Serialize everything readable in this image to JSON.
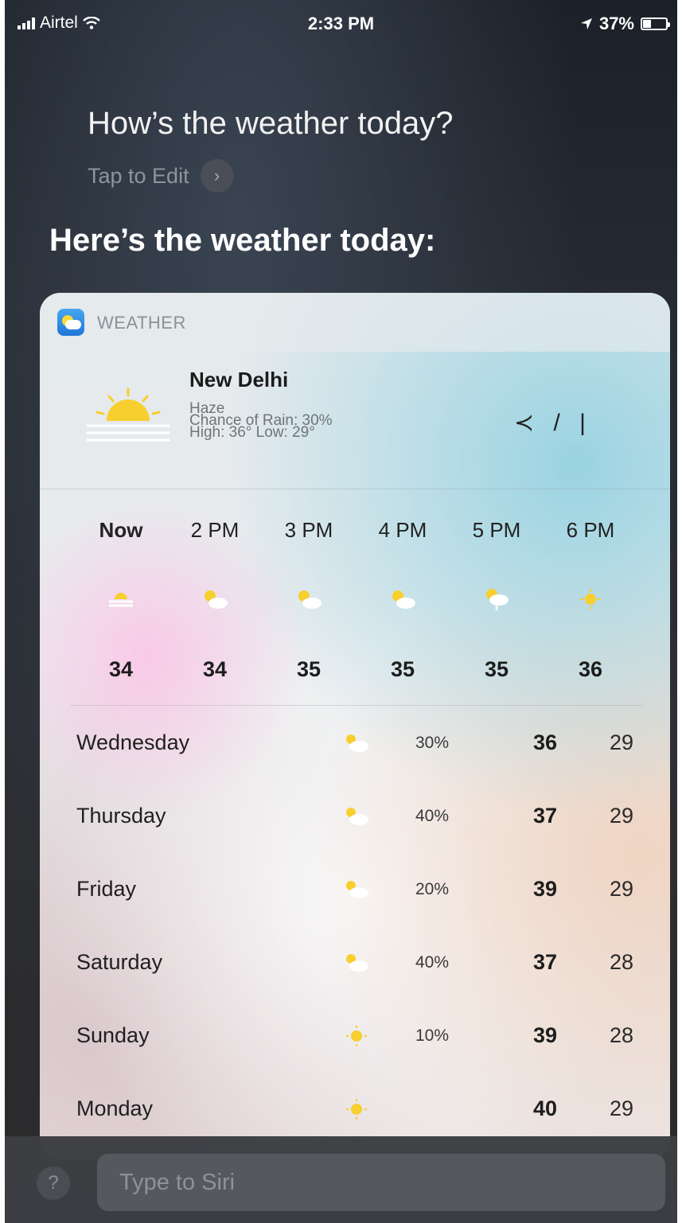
{
  "status_bar": {
    "carrier": "Airtel",
    "time": "2:33 PM",
    "battery": "37%",
    "battery_level": 0.37
  },
  "siri": {
    "query": "How’s the weather today?",
    "tap_to_edit": "Tap to Edit",
    "answer": "Here’s the weather today:"
  },
  "weather": {
    "app_name": "WEATHER",
    "city": "New Delhi",
    "condition": "Haze",
    "chance_of_rain": "Chance of Rain: 30%",
    "high_low": "High: 36° Low: 29°",
    "glyphs": "≺ / |",
    "hourly": [
      {
        "label": "Now",
        "temp": "34",
        "icon": "haze-icon"
      },
      {
        "label": "2 PM",
        "temp": "34",
        "icon": "partly-cloudy-icon"
      },
      {
        "label": "3 PM",
        "temp": "35",
        "icon": "partly-cloudy-icon"
      },
      {
        "label": "4 PM",
        "temp": "35",
        "icon": "partly-cloudy-icon"
      },
      {
        "label": "5 PM",
        "temp": "35",
        "icon": "rain-cloud-icon"
      },
      {
        "label": "6 PM",
        "temp": "36",
        "icon": "sun-icon"
      }
    ],
    "daily": [
      {
        "day": "Wednesday",
        "rain": "30%",
        "high": "36",
        "low": "29",
        "icon": "partly-cloudy-icon"
      },
      {
        "day": "Thursday",
        "rain": "40%",
        "high": "37",
        "low": "29",
        "icon": "partly-cloudy-icon"
      },
      {
        "day": "Friday",
        "rain": "20%",
        "high": "39",
        "low": "29",
        "icon": "partly-cloudy-icon"
      },
      {
        "day": "Saturday",
        "rain": "40%",
        "high": "37",
        "low": "28",
        "icon": "partly-cloudy-icon"
      },
      {
        "day": "Sunday",
        "rain": "10%",
        "high": "39",
        "low": "28",
        "icon": "sun-icon"
      },
      {
        "day": "Monday",
        "rain": "",
        "high": "40",
        "low": "29",
        "icon": "sun-icon"
      }
    ]
  },
  "input": {
    "placeholder": "Type to Siri",
    "help": "?"
  },
  "colors": {
    "sun": "#f7cf2e",
    "cloud": "#ffffff"
  }
}
